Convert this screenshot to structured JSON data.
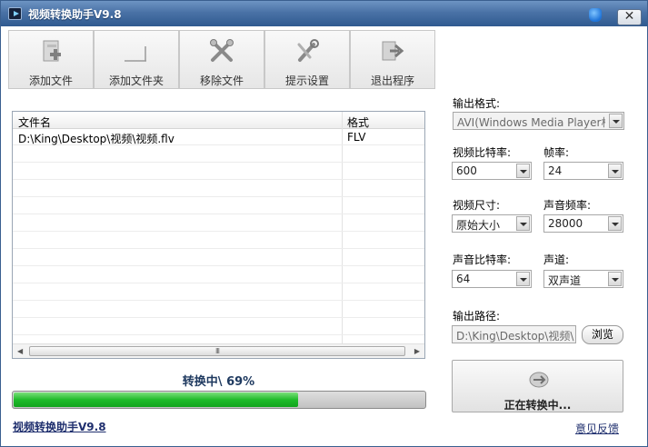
{
  "window": {
    "title": "视频转换助手V9.8",
    "close_label": "✕"
  },
  "toolbar": {
    "add_file": "添加文件",
    "add_folder": "添加文件夹",
    "remove_file": "移除文件",
    "prompt_settings": "提示设置",
    "exit": "退出程序"
  },
  "file_list": {
    "columns": [
      "文件名",
      "格式"
    ],
    "rows": [
      {
        "name": "D:\\King\\Desktop\\视频\\视频.flv",
        "format": "FLV"
      }
    ],
    "scroll_grip": "III"
  },
  "progress": {
    "label": "转换中\\ 69%",
    "fraction": 0.69
  },
  "settings": {
    "output_format_label": "输出格式:",
    "output_format_value": "AVI(Windows Media Player格式)",
    "video_bitrate_label": "视频比特率:",
    "video_bitrate_value": "600",
    "frame_rate_label": "帧率:",
    "frame_rate_value": "24",
    "video_size_label": "视频尺寸:",
    "video_size_value": "原始大小",
    "audio_rate_label": "声音频率:",
    "audio_rate_value": "28000",
    "audio_bitrate_label": "声音比特率:",
    "audio_bitrate_value": "64",
    "channel_label": "声道:",
    "channel_value": "双声道",
    "output_path_label": "输出路径:",
    "output_path_value": "D:\\King\\Desktop\\视频\\",
    "browse_label": "浏览"
  },
  "start": {
    "label": "正在转换中..."
  },
  "footer": {
    "app_link": "视频转换助手V9.8",
    "feedback_link": "意见反馈"
  }
}
